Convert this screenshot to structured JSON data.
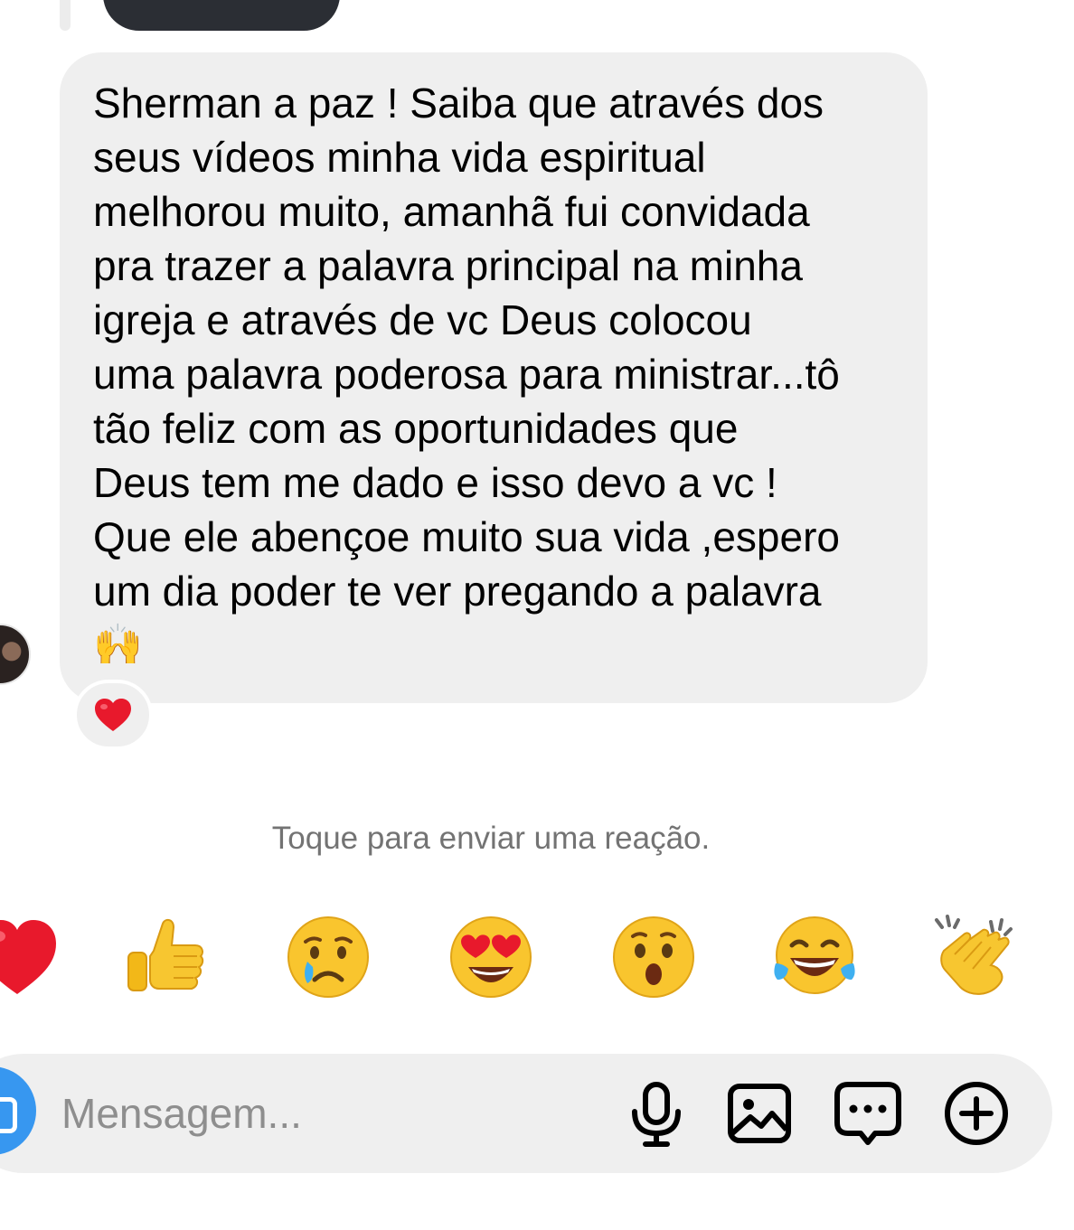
{
  "message": {
    "text": "Sherman a paz ! Saiba que através dos\nseus vídeos minha vida espiritual\nmelhorou muito, amanhã fui convidada\npra trazer a palavra principal na minha\nigreja e através de vc Deus colocou\numa palavra poderosa para ministrar...tô\ntão feliz com as oportunidades que\nDeus tem me dado e isso devo a vc !\nQue ele abençoe muito sua vida ,espero\num dia poder te ver pregando a palavra",
    "trailing_emoji": "🙌"
  },
  "reaction_on_message": "heart-emoji",
  "hint": "Toque para enviar uma reação.",
  "reactions": [
    {
      "name": "heart-emoji"
    },
    {
      "name": "thumbs-up-emoji"
    },
    {
      "name": "crying-face-emoji"
    },
    {
      "name": "heart-eyes-emoji"
    },
    {
      "name": "surprised-face-emoji"
    },
    {
      "name": "tears-of-joy-emoji"
    },
    {
      "name": "clapping-hands-emoji"
    }
  ],
  "composer": {
    "placeholder": "Mensagem...",
    "tools": [
      "microphone-icon",
      "gallery-icon",
      "sticker-chat-icon",
      "plus-circle-icon"
    ]
  },
  "colors": {
    "bubble": "#efefef",
    "hint": "#737373",
    "placeholder": "#8e8e8e",
    "camera_button": "#3797f0",
    "heart": "#e8192c"
  }
}
